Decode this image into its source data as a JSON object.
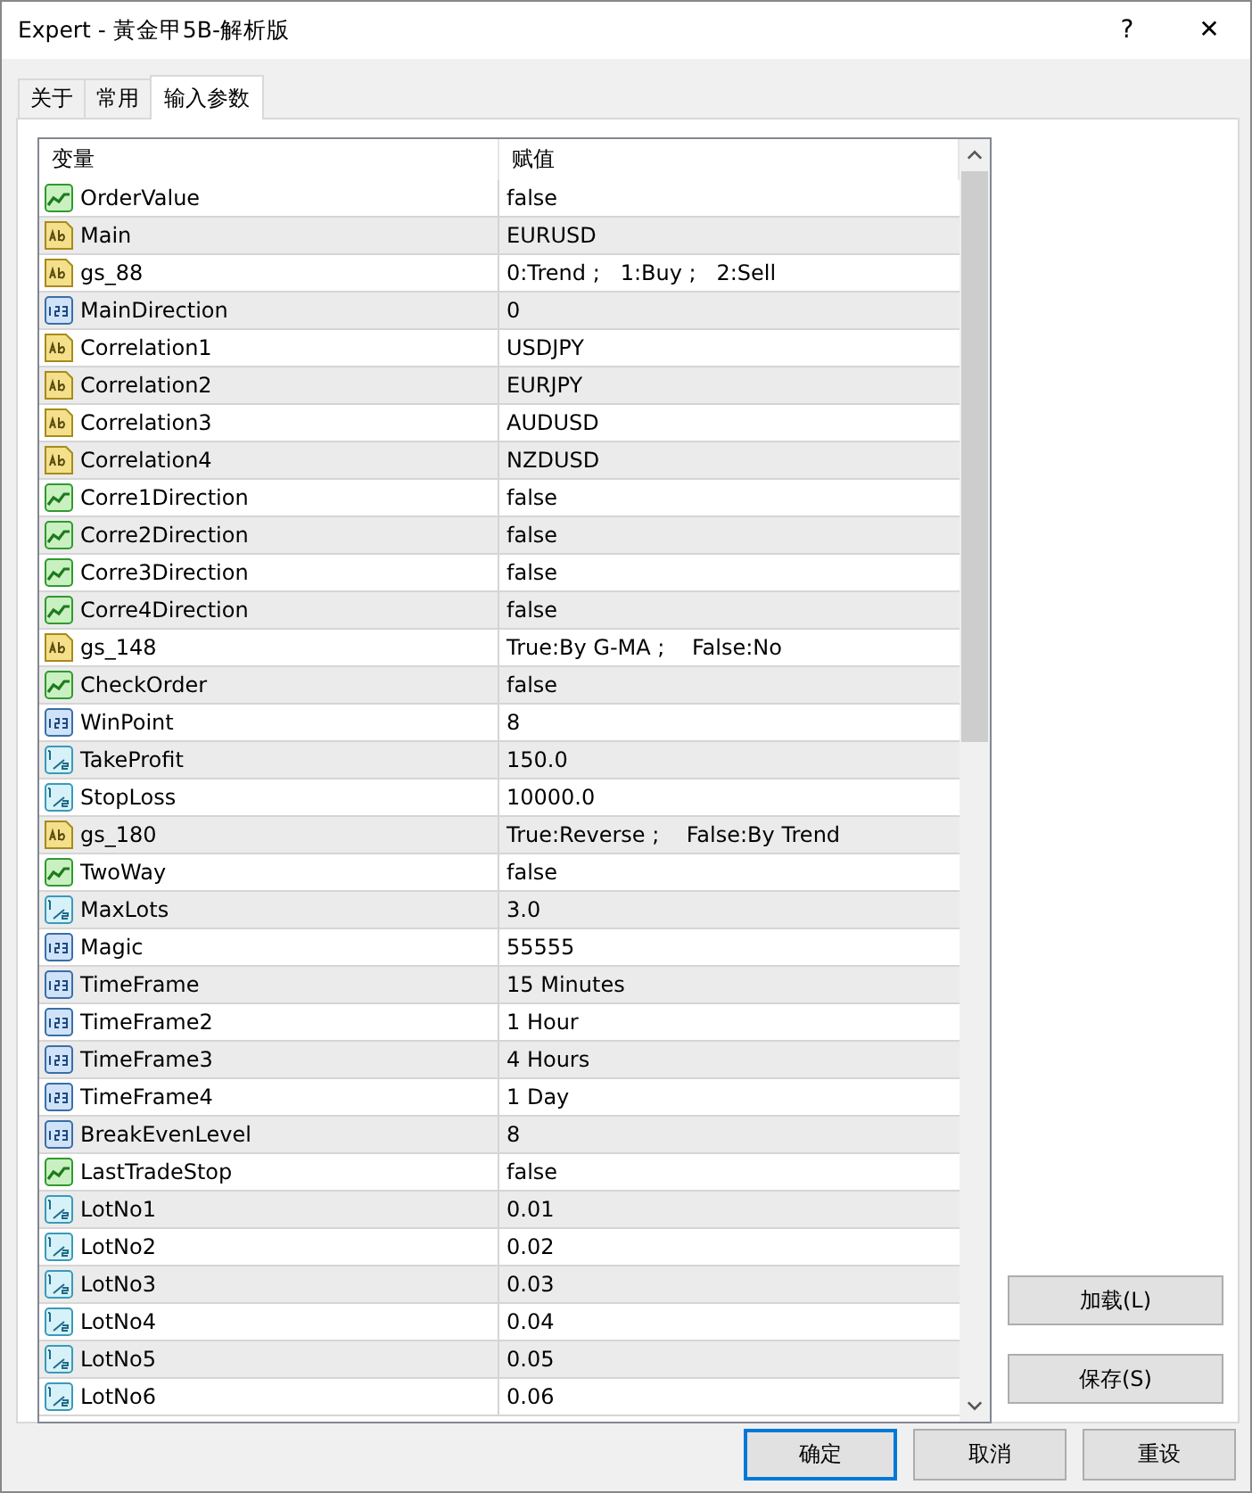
{
  "window": {
    "title": "Expert - 黃金甲5B-解析版",
    "help": "?",
    "close": "✕"
  },
  "tabs": [
    {
      "label": "关于",
      "selected": false
    },
    {
      "label": "常用",
      "selected": false
    },
    {
      "label": "输入参数",
      "selected": true
    }
  ],
  "table": {
    "columns": [
      "变量",
      "赋值"
    ],
    "rows": [
      {
        "kind": "bool",
        "name": "OrderValue",
        "value": "false"
      },
      {
        "kind": "string",
        "name": "Main",
        "value": "EURUSD"
      },
      {
        "kind": "string",
        "name": "gs_88",
        "value": "0:Trend ;   1:Buy ;   2:Sell"
      },
      {
        "kind": "int",
        "name": "MainDirection",
        "value": "0"
      },
      {
        "kind": "string",
        "name": "Correlation1",
        "value": "USDJPY"
      },
      {
        "kind": "string",
        "name": "Correlation2",
        "value": "EURJPY"
      },
      {
        "kind": "string",
        "name": "Correlation3",
        "value": "AUDUSD"
      },
      {
        "kind": "string",
        "name": "Correlation4",
        "value": "NZDUSD"
      },
      {
        "kind": "bool",
        "name": "Corre1Direction",
        "value": "false"
      },
      {
        "kind": "bool",
        "name": "Corre2Direction",
        "value": "false"
      },
      {
        "kind": "bool",
        "name": "Corre3Direction",
        "value": "false"
      },
      {
        "kind": "bool",
        "name": "Corre4Direction",
        "value": "false"
      },
      {
        "kind": "string",
        "name": "gs_148",
        "value": "True:By G-MA ;    False:No"
      },
      {
        "kind": "bool",
        "name": "CheckOrder",
        "value": "false"
      },
      {
        "kind": "int",
        "name": "WinPoint",
        "value": "8"
      },
      {
        "kind": "double",
        "name": "TakeProfit",
        "value": "150.0"
      },
      {
        "kind": "double",
        "name": "StopLoss",
        "value": "10000.0"
      },
      {
        "kind": "string",
        "name": "gs_180",
        "value": "True:Reverse ;    False:By Trend"
      },
      {
        "kind": "bool",
        "name": "TwoWay",
        "value": "false"
      },
      {
        "kind": "double",
        "name": "MaxLots",
        "value": "3.0"
      },
      {
        "kind": "int",
        "name": "Magic",
        "value": "55555"
      },
      {
        "kind": "int",
        "name": "TimeFrame",
        "value": "15 Minutes"
      },
      {
        "kind": "int",
        "name": "TimeFrame2",
        "value": "1 Hour"
      },
      {
        "kind": "int",
        "name": "TimeFrame3",
        "value": "4 Hours"
      },
      {
        "kind": "int",
        "name": "TimeFrame4",
        "value": "1 Day"
      },
      {
        "kind": "int",
        "name": "BreakEvenLevel",
        "value": "8"
      },
      {
        "kind": "bool",
        "name": "LastTradeStop",
        "value": "false"
      },
      {
        "kind": "double",
        "name": "LotNo1",
        "value": "0.01"
      },
      {
        "kind": "double",
        "name": "LotNo2",
        "value": "0.02"
      },
      {
        "kind": "double",
        "name": "LotNo3",
        "value": "0.03"
      },
      {
        "kind": "double",
        "name": "LotNo4",
        "value": "0.04"
      },
      {
        "kind": "double",
        "name": "LotNo5",
        "value": "0.05"
      },
      {
        "kind": "double",
        "name": "LotNo6",
        "value": "0.06"
      }
    ]
  },
  "side_buttons": [
    "加载(L)",
    "保存(S)"
  ],
  "buttons": [
    {
      "label": "确定",
      "default": true
    },
    {
      "label": "取消",
      "default": false
    },
    {
      "label": "重设",
      "default": false
    }
  ]
}
